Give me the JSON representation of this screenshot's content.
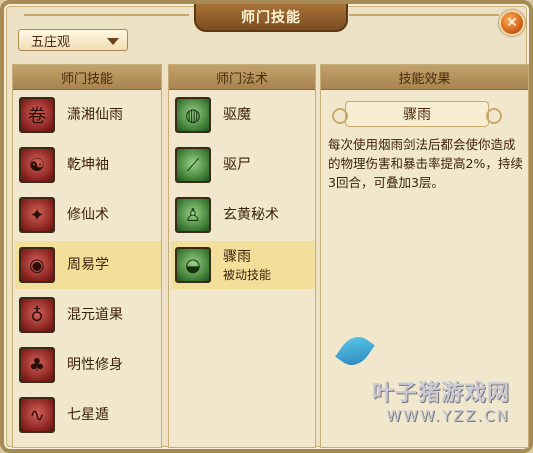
{
  "window": {
    "title": "师门技能"
  },
  "school_dropdown": {
    "selected": "五庄观"
  },
  "panels": {
    "skills_header": "师门技能",
    "spells_header": "师门法术",
    "effect_header": "技能效果"
  },
  "skills": [
    {
      "label": "潇湘仙雨",
      "icon": "scroll-icon",
      "selected": false
    },
    {
      "label": "乾坤袖",
      "icon": "taiji-sleeve-icon",
      "selected": false
    },
    {
      "label": "修仙术",
      "icon": "immortal-figure-icon",
      "selected": false
    },
    {
      "label": "周易学",
      "icon": "tablet-icon",
      "selected": true
    },
    {
      "label": "混元道果",
      "icon": "gourd-icon",
      "selected": false
    },
    {
      "label": "明性修身",
      "icon": "tree-icon",
      "selected": false
    },
    {
      "label": "七星遁",
      "icon": "star-path-icon",
      "selected": false
    }
  ],
  "spells": [
    {
      "label": "驱魔",
      "sublabel": "",
      "icon": "bag-icon",
      "selected": false
    },
    {
      "label": "驱尸",
      "sublabel": "",
      "icon": "whisk-icon",
      "selected": false
    },
    {
      "label": "玄黄秘术",
      "sublabel": "",
      "icon": "meditation-icon",
      "selected": false
    },
    {
      "label": "骤雨",
      "sublabel": "被动技能",
      "icon": "cauldron-icon",
      "selected": true
    }
  ],
  "effect": {
    "title": "骤雨",
    "description": "每次使用烟雨剑法后都会使你造成的物理伤害和暴击率提高2%，持续3回合，可叠加3层。"
  },
  "watermark": {
    "main": "叶子猪游戏网",
    "sub": "WWW.YZZ.CN"
  }
}
